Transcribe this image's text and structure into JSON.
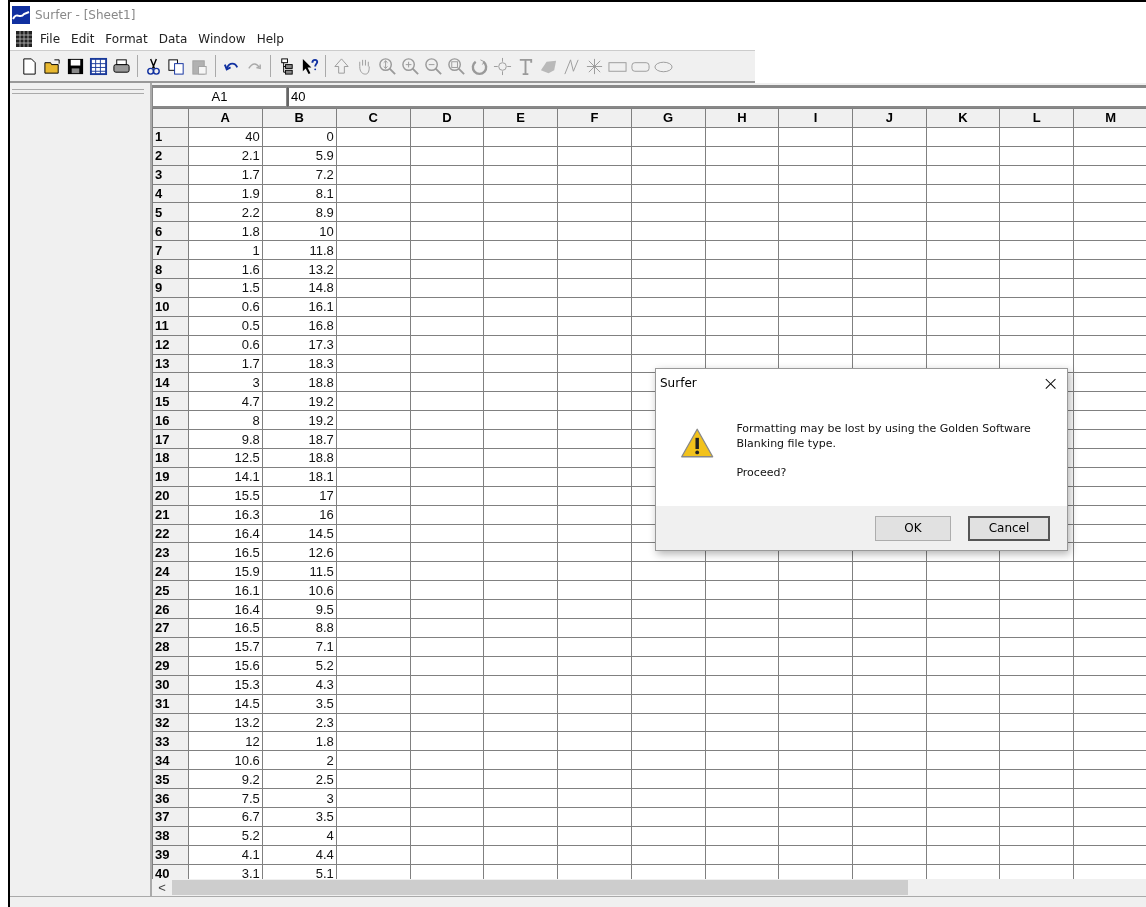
{
  "window": {
    "title": "Surfer - [Sheet1]"
  },
  "menu": [
    "File",
    "Edit",
    "Format",
    "Data",
    "Window",
    "Help"
  ],
  "toolbar": [
    {
      "disabled": false
    },
    {
      "disabled": false
    },
    {
      "disabled": false
    },
    {
      "disabled": false
    },
    {
      "disabled": false
    },
    {
      "disabled": false
    },
    {
      "disabled": false
    },
    {
      "disabled": true
    },
    {
      "disabled": false
    },
    {
      "disabled": true
    },
    {
      "disabled": false
    },
    {
      "disabled": false
    },
    {
      "disabled": true
    },
    {
      "disabled": true
    },
    {
      "disabled": true
    },
    {
      "disabled": true
    },
    {
      "disabled": true
    },
    {
      "disabled": true
    },
    {
      "disabled": true
    },
    {
      "disabled": true
    },
    {
      "disabled": true
    },
    {
      "disabled": true
    },
    {
      "disabled": true
    },
    {
      "disabled": true
    },
    {
      "disabled": true
    },
    {
      "disabled": true
    },
    {
      "disabled": true
    }
  ],
  "cell_reference": "A1",
  "formula": "40",
  "columns": [
    "A",
    "B",
    "C",
    "D",
    "E",
    "F",
    "G",
    "H",
    "I",
    "J",
    "K",
    "L",
    "M"
  ],
  "rows": [
    {
      "number": "1",
      "cells": [
        "40",
        "0"
      ]
    },
    {
      "number": "2",
      "cells": [
        "2.1",
        "5.9"
      ]
    },
    {
      "number": "3",
      "cells": [
        "1.7",
        "7.2"
      ]
    },
    {
      "number": "4",
      "cells": [
        "1.9",
        "8.1"
      ]
    },
    {
      "number": "5",
      "cells": [
        "2.2",
        "8.9"
      ]
    },
    {
      "number": "6",
      "cells": [
        "1.8",
        "10"
      ]
    },
    {
      "number": "7",
      "cells": [
        "1",
        "11.8"
      ]
    },
    {
      "number": "8",
      "cells": [
        "1.6",
        "13.2"
      ]
    },
    {
      "number": "9",
      "cells": [
        "1.5",
        "14.8"
      ]
    },
    {
      "number": "10",
      "cells": [
        "0.6",
        "16.1"
      ]
    },
    {
      "number": "11",
      "cells": [
        "0.5",
        "16.8"
      ]
    },
    {
      "number": "12",
      "cells": [
        "0.6",
        "17.3"
      ]
    },
    {
      "number": "13",
      "cells": [
        "1.7",
        "18.3"
      ]
    },
    {
      "number": "14",
      "cells": [
        "3",
        "18.8"
      ]
    },
    {
      "number": "15",
      "cells": [
        "4.7",
        "19.2"
      ]
    },
    {
      "number": "16",
      "cells": [
        "8",
        "19.2"
      ]
    },
    {
      "number": "17",
      "cells": [
        "9.8",
        "18.7"
      ]
    },
    {
      "number": "18",
      "cells": [
        "12.5",
        "18.8"
      ]
    },
    {
      "number": "19",
      "cells": [
        "14.1",
        "18.1"
      ]
    },
    {
      "number": "20",
      "cells": [
        "15.5",
        "17"
      ]
    },
    {
      "number": "21",
      "cells": [
        "16.3",
        "16"
      ]
    },
    {
      "number": "22",
      "cells": [
        "16.4",
        "14.5"
      ]
    },
    {
      "number": "23",
      "cells": [
        "16.5",
        "12.6"
      ]
    },
    {
      "number": "24",
      "cells": [
        "15.9",
        "11.5"
      ]
    },
    {
      "number": "25",
      "cells": [
        "16.1",
        "10.6"
      ]
    },
    {
      "number": "26",
      "cells": [
        "16.4",
        "9.5"
      ]
    },
    {
      "number": "27",
      "cells": [
        "16.5",
        "8.8"
      ]
    },
    {
      "number": "28",
      "cells": [
        "15.7",
        "7.1"
      ]
    },
    {
      "number": "29",
      "cells": [
        "15.6",
        "5.2"
      ]
    },
    {
      "number": "30",
      "cells": [
        "15.3",
        "4.3"
      ]
    },
    {
      "number": "31",
      "cells": [
        "14.5",
        "3.5"
      ]
    },
    {
      "number": "32",
      "cells": [
        "13.2",
        "2.3"
      ]
    },
    {
      "number": "33",
      "cells": [
        "12",
        "1.8"
      ]
    },
    {
      "number": "34",
      "cells": [
        "10.6",
        "2"
      ]
    },
    {
      "number": "35",
      "cells": [
        "9.2",
        "2.5"
      ]
    },
    {
      "number": "36",
      "cells": [
        "7.5",
        "3"
      ]
    },
    {
      "number": "37",
      "cells": [
        "6.7",
        "3.5"
      ]
    },
    {
      "number": "38",
      "cells": [
        "5.2",
        "4"
      ]
    },
    {
      "number": "39",
      "cells": [
        "4.1",
        "4.4"
      ]
    },
    {
      "number": "40",
      "cells": [
        "3.1",
        "5.1"
      ]
    }
  ],
  "scrollbar": {
    "left_arrow": "<"
  },
  "dialog": {
    "title": "Surfer",
    "close": "×",
    "message": "Formatting may be lost by using the Golden Software Blanking file type.",
    "question": "Proceed?",
    "buttons": [
      "OK",
      "Cancel"
    ]
  }
}
